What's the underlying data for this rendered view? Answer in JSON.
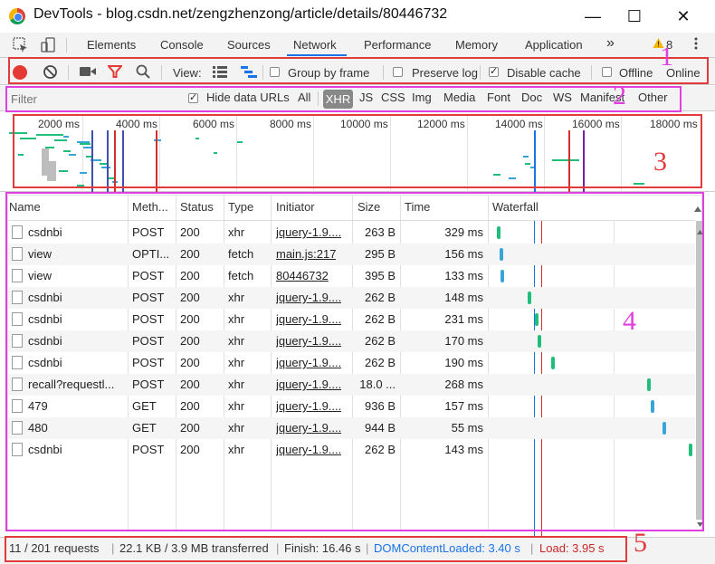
{
  "window": {
    "title": "DevTools - blog.csdn.net/zengzhenzong/article/details/80446732",
    "minimize": "—",
    "maximize": "☐",
    "close": "✕"
  },
  "tabs": [
    {
      "label": "Elements"
    },
    {
      "label": "Console"
    },
    {
      "label": "Sources"
    },
    {
      "label": "Network",
      "active": true
    },
    {
      "label": "Performance"
    },
    {
      "label": "Memory"
    },
    {
      "label": "Application"
    }
  ],
  "tabs_more": "»",
  "warning_count": "8",
  "toolbar": {
    "view_label": "View:",
    "group_by_frame": "Group by frame",
    "preserve_log": "Preserve log",
    "disable_cache": "Disable cache",
    "offline": "Offline",
    "online": "Online"
  },
  "filter": {
    "placeholder": "Filter",
    "hide_data_urls": "Hide data URLs",
    "types": [
      "All",
      "XHR",
      "JS",
      "CSS",
      "Img",
      "Media",
      "Font",
      "Doc",
      "WS",
      "Manifest",
      "Other"
    ],
    "active_type": "XHR"
  },
  "overview": {
    "ticks": [
      "2000 ms",
      "4000 ms",
      "6000 ms",
      "8000 ms",
      "10000 ms",
      "12000 ms",
      "14000 ms",
      "16000 ms",
      "18000 ms"
    ]
  },
  "table": {
    "headers": [
      "Name",
      "Meth...",
      "Status",
      "Type",
      "Initiator",
      "Size",
      "Time",
      "Waterfall"
    ],
    "rows": [
      {
        "name": "csdnbi",
        "method": "POST",
        "status": "200",
        "type": "xhr",
        "initiator": "jquery-1.9....",
        "size": "263 B",
        "time": "329 ms",
        "wf": 0.028
      },
      {
        "name": "view",
        "method": "OPTI...",
        "status": "200",
        "type": "fetch",
        "initiator": "main.js:217",
        "size": "295 B",
        "time": "156 ms",
        "wf": 0.04
      },
      {
        "name": "view",
        "method": "POST",
        "status": "200",
        "type": "fetch",
        "initiator": "80446732",
        "size": "395 B",
        "time": "133 ms",
        "wf": 0.045
      },
      {
        "name": "csdnbi",
        "method": "POST",
        "status": "200",
        "type": "xhr",
        "initiator": "jquery-1.9....",
        "size": "262 B",
        "time": "148 ms",
        "wf": 0.18
      },
      {
        "name": "csdnbi",
        "method": "POST",
        "status": "200",
        "type": "xhr",
        "initiator": "jquery-1.9....",
        "size": "262 B",
        "time": "231 ms",
        "wf": 0.22
      },
      {
        "name": "csdnbi",
        "method": "POST",
        "status": "200",
        "type": "xhr",
        "initiator": "jquery-1.9....",
        "size": "262 B",
        "time": "170 ms",
        "wf": 0.23
      },
      {
        "name": "csdnbi",
        "method": "POST",
        "status": "200",
        "type": "xhr",
        "initiator": "jquery-1.9....",
        "size": "262 B",
        "time": "190 ms",
        "wf": 0.3
      },
      {
        "name": "recall?requestl...",
        "method": "POST",
        "status": "200",
        "type": "xhr",
        "initiator": "jquery-1.9....",
        "size": "18.0 ...",
        "time": "268 ms",
        "wf": 0.78
      },
      {
        "name": "479",
        "method": "GET",
        "status": "200",
        "type": "xhr",
        "initiator": "jquery-1.9....",
        "size": "936 B",
        "time": "157 ms",
        "wf": 0.8
      },
      {
        "name": "480",
        "method": "GET",
        "status": "200",
        "type": "xhr",
        "initiator": "jquery-1.9....",
        "size": "944 B",
        "time": "55 ms",
        "wf": 0.86
      },
      {
        "name": "csdnbi",
        "method": "POST",
        "status": "200",
        "type": "xhr",
        "initiator": "jquery-1.9....",
        "size": "262 B",
        "time": "143 ms",
        "wf": 0.99
      }
    ]
  },
  "status": {
    "requests": "11 / 201 requests",
    "transferred": "22.1 KB / 3.9 MB transferred",
    "finish": "Finish: 16.46 s",
    "dcl": "DOMContentLoaded: 3.40 s",
    "load": "Load: 3.95 s"
  },
  "annotations": [
    "1",
    "2",
    "3",
    "4",
    "5"
  ],
  "colors": {
    "record": "#e53935",
    "accent": "#1a73e8",
    "annotation_red": "#e23b3b",
    "annotation_magenta": "#e040e0",
    "bar_green": "#1fbf7a",
    "bar_blue": "#38a5d8"
  }
}
